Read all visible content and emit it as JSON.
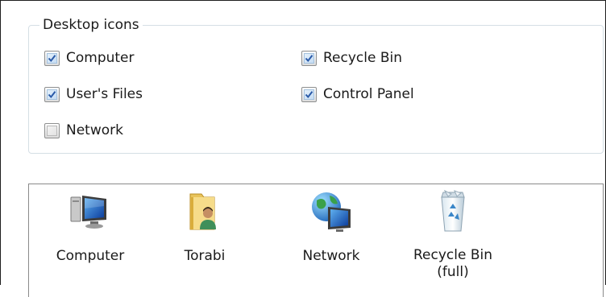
{
  "desktop_icons": {
    "legend": "Desktop icons",
    "options": [
      {
        "label": "Computer",
        "checked": true
      },
      {
        "label": "Recycle Bin",
        "checked": true
      },
      {
        "label": "User's Files",
        "checked": true
      },
      {
        "label": "Control Panel",
        "checked": true
      },
      {
        "label": "Network",
        "checked": false
      }
    ]
  },
  "preview": {
    "items": [
      {
        "label": "Computer",
        "icon": "computer-icon"
      },
      {
        "label": "Torabi",
        "icon": "user-folder-icon"
      },
      {
        "label": "Network",
        "icon": "network-icon"
      },
      {
        "label": "Recycle Bin\n(full)",
        "icon": "recycle-bin-full-icon"
      }
    ]
  },
  "colors": {
    "check_accent": "#2a5aa8",
    "group_border": "#d5dfe5",
    "selection_border": "#8a8a8a"
  }
}
